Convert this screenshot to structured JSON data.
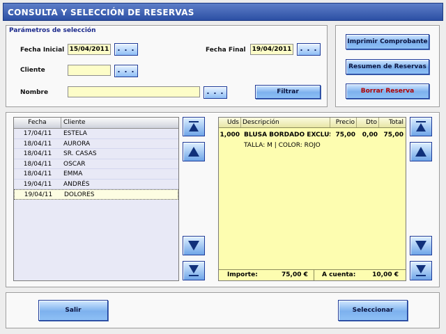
{
  "window": {
    "title": "CONSULTA Y SELECCIÓN DE RESERVAS"
  },
  "params": {
    "section_label": "Parámetros de selección",
    "fecha_inicial_label": "Fecha Inicial",
    "fecha_inicial_value": "15/04/2011",
    "fecha_final_label": "Fecha Final",
    "fecha_final_value": "19/04/2011",
    "cliente_label": "Cliente",
    "cliente_value": "",
    "nombre_label": "Nombre",
    "nombre_value": "",
    "dots_label": ". . .",
    "filter_label": "Filtrar"
  },
  "actions": {
    "print_label": "Imprimir Comprobante",
    "summary_label": "Resumen de Reservas",
    "delete_label": "Borrar Reserva"
  },
  "reservations": {
    "headers": {
      "date": "Fecha",
      "client": "Cliente"
    },
    "rows": [
      {
        "date": "17/04/11",
        "client": "ESTELA"
      },
      {
        "date": "18/04/11",
        "client": "AURORA"
      },
      {
        "date": "18/04/11",
        "client": "SR. CASAS"
      },
      {
        "date": "18/04/11",
        "client": "OSCAR"
      },
      {
        "date": "18/04/11",
        "client": "EMMA"
      },
      {
        "date": "19/04/11",
        "client": "ANDRÉS"
      },
      {
        "date": "19/04/11",
        "client": "DOLORES"
      }
    ],
    "selected_index": 6
  },
  "detail": {
    "headers": {
      "uds": "Uds",
      "desc": "Descripción",
      "precio": "Precio",
      "dto": "Dto",
      "total": "Total"
    },
    "line": {
      "uds": "1,000",
      "desc": "BLUSA BORDADO EXCLUSI",
      "precio": "75,00",
      "dto": "0,00",
      "total": "75,00"
    },
    "line_note": "TALLA: M | COLOR: ROJO",
    "importe_label": "Importe:",
    "importe_value": "75,00 €",
    "acuenta_label": "A cuenta:",
    "acuenta_value": "10,00 €"
  },
  "footer": {
    "exit_label": "Salir",
    "select_label": "Seleccionar"
  },
  "colors": {
    "title_bar": "#2c4fa4",
    "field_bg": "#fdfdc8",
    "detail_bg": "#fdfdb0",
    "danger_text": "#b00000"
  },
  "icons": {
    "first": "arrow-first-icon",
    "up": "arrow-up-icon",
    "down": "arrow-down-icon",
    "last": "arrow-last-icon"
  }
}
